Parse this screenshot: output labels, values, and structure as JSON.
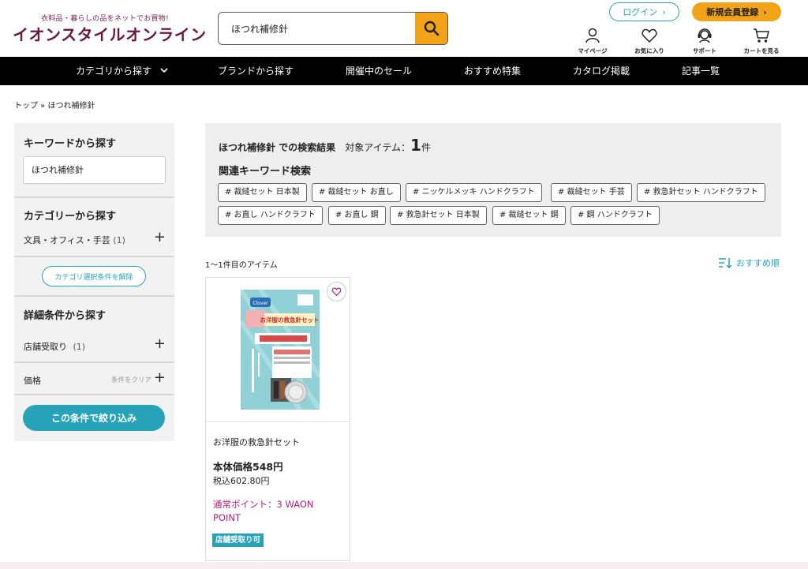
{
  "header": {
    "logo_tagline": "衣料品・暮らしの品をネットでお買物!",
    "logo_name": "イオンスタイルオンライン",
    "search_value": "ほつれ補修針",
    "login_label": "ログイン",
    "register_label": "新規会員登録",
    "icons": [
      {
        "name": "mypage-icon",
        "label": "マイページ"
      },
      {
        "name": "heart-icon",
        "label": "お気に入り"
      },
      {
        "name": "support-icon",
        "label": "サポート"
      },
      {
        "name": "cart-icon",
        "label": "カートを見る"
      }
    ],
    "colors": {
      "brand": "#6b1843",
      "accent": "#f3a318",
      "teal": "#27a3b9"
    }
  },
  "nav": {
    "items": [
      "カテゴリから探す",
      "ブランドから探す",
      "開催中のセール",
      "おすすめ特集",
      "カタログ掲載",
      "記事一覧"
    ]
  },
  "breadcrumb": "トップ » ほつれ補修針",
  "sidebar": {
    "keyword_title": "キーワードから探す",
    "keyword_value": "ほつれ補修針",
    "category_title": "カテゴリーから探す",
    "category_item": "文具・オフィス・手芸",
    "category_count": "(1)",
    "clear_category_label": "カテゴリ選択条件を解除",
    "detail_title": "詳細条件から探す",
    "store_pickup_label": "店舗受取り",
    "store_pickup_count": "(1)",
    "price_label": "価格",
    "clear_condition_label": "条件をクリア",
    "narrow_button_label": "この条件で絞り込み"
  },
  "results": {
    "query_label": "ほつれ補修針 での検索結果",
    "items_label": "対象アイテム：",
    "items_count": "1",
    "items_unit": "件",
    "related_title": "関連キーワード検索",
    "tags_row1": [
      "# 裁縫セット 日本製",
      "# 裁縫セット お直し",
      "# ニッケルメッキ ハンドクラフト",
      "# 裁縫セット 手芸",
      "# 救急針セット ハンドクラフト"
    ],
    "tags_row2": [
      "# お直し ハンドクラフト",
      "# お直し 鋼",
      "# 救急針セット 日本製",
      "# 裁縫セット 鋼",
      "# 鋼 ハンドクラフト"
    ],
    "count_text": "1〜1件目のアイテム",
    "sort_label": "おすすめ順"
  },
  "product": {
    "name": "お洋服の救急針セット",
    "price": "本体価格548円",
    "tax_price": "税込602.80円",
    "points": "通常ポイント：3 WAON POINT",
    "badge": "店舗受取り可",
    "package_brand": "Clover",
    "package_title": "お洋服の救急針セット"
  }
}
